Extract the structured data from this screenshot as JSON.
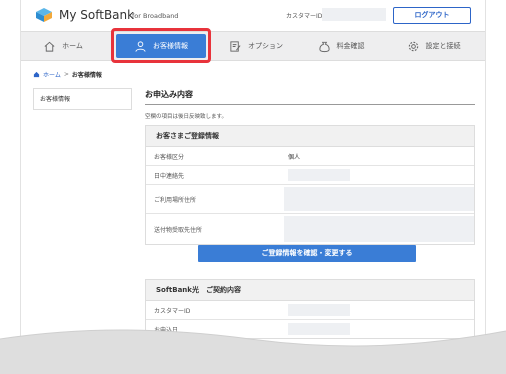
{
  "header": {
    "brand": "My SoftBank",
    "brand_sub": "for Broadband",
    "customer_label": "カスタマーID：",
    "logout_label": "ログアウト"
  },
  "nav": {
    "items": [
      {
        "label": "ホーム",
        "icon": "home-icon"
      },
      {
        "label": "お客様情報",
        "icon": "person-icon",
        "active": true
      },
      {
        "label": "オプション",
        "icon": "edit-doc-icon"
      },
      {
        "label": "料金確認",
        "icon": "money-bag-icon"
      },
      {
        "label": "設定と接続",
        "icon": "gear-icon"
      }
    ]
  },
  "breadcrumb": {
    "home": "ホーム",
    "separator": ">",
    "current": "お客様情報"
  },
  "sidebar": {
    "items": [
      {
        "label": "お客様情報"
      }
    ]
  },
  "main": {
    "title": "お申込み内容",
    "note": "空欄の項目は後日反映致します。",
    "registration": {
      "heading": "お客さまご登録情報",
      "rows": [
        {
          "label": "お客様区分",
          "value": "個人"
        },
        {
          "label": "日中連絡先",
          "value": ""
        },
        {
          "label": "ご利用場所住所",
          "value": ""
        },
        {
          "label": "送付物受取先住所",
          "value": ""
        }
      ]
    },
    "confirm_button": "ご登録情報を確認・変更する",
    "contract": {
      "heading": "SoftBank光　ご契約内容",
      "rows": [
        {
          "label": "カスタマーID",
          "value": ""
        },
        {
          "label": "お申込日",
          "value": ""
        }
      ]
    }
  },
  "colors": {
    "accent": "#3a7dd6",
    "highlight": "#e8333b",
    "link": "#2d65c8"
  }
}
